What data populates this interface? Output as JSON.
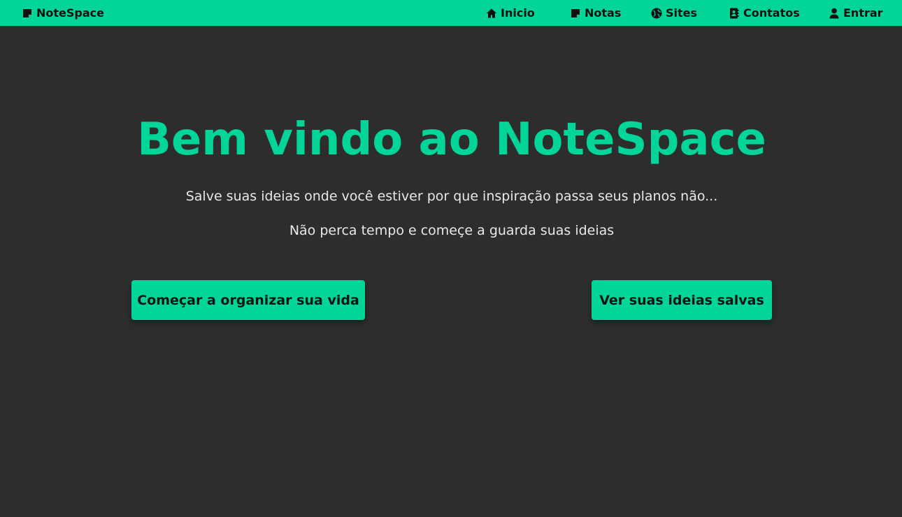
{
  "colors": {
    "accent": "#03d497",
    "background": "#2d2d2d",
    "nav_text": "#111111",
    "body_text": "#e8e8e8"
  },
  "navbar": {
    "brand": {
      "label": "NoteSpace",
      "icon": "note-icon"
    },
    "items": [
      {
        "label": "Inicio",
        "icon": "home-icon"
      },
      {
        "label": "Notas",
        "icon": "note-icon"
      },
      {
        "label": "Sites",
        "icon": "globe-icon"
      },
      {
        "label": "Contatos",
        "icon": "contact-book-icon"
      },
      {
        "label": "Entrar",
        "icon": "user-icon"
      }
    ]
  },
  "hero": {
    "title": "Bem vindo ao NoteSpace",
    "subtitle_1": "Salve suas ideias onde você estiver por que inspiração passa seus planos não...",
    "subtitle_2": "Não perca tempo e começe a guarda suas ideias",
    "primary_button": "Começar a organizar sua vida",
    "secondary_button": "Ver suas ideias salvas"
  }
}
